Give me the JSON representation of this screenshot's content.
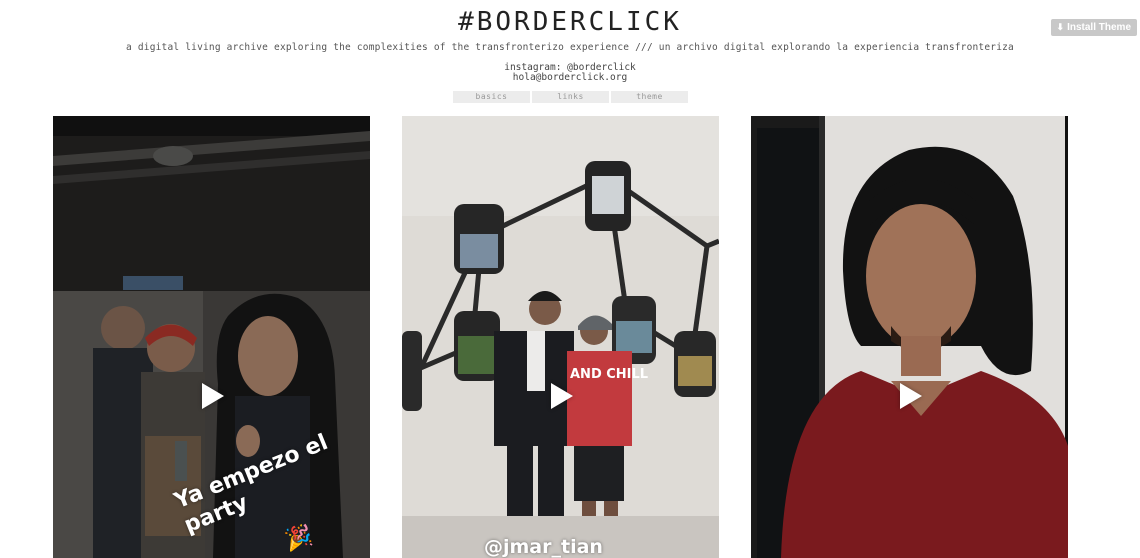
{
  "site": {
    "title": "#BORDERCLICK",
    "description": "a digital living archive exploring the complexities of the transfronterizo experience /// un archivo digital explorando la experiencia transfronteriza",
    "instagram": "instagram: @borderclick",
    "email": "hola@borderclick.org"
  },
  "install_button": {
    "label": "Install Theme",
    "icon": "download-icon"
  },
  "nav": {
    "items": [
      "basics",
      "links",
      "theme"
    ]
  },
  "posts": [
    {
      "type": "video",
      "caption_text": "Ya empezo el party",
      "icon": "play-icon",
      "sticker_icon": "party-popper-icon"
    },
    {
      "type": "video",
      "caption_text": "@jmar_tian",
      "icon": "play-icon"
    },
    {
      "type": "video",
      "icon": "play-icon"
    }
  ],
  "colors": {
    "install_bg": "#c8c8c8",
    "nav_bg": "#ececec",
    "title": "#222222"
  }
}
